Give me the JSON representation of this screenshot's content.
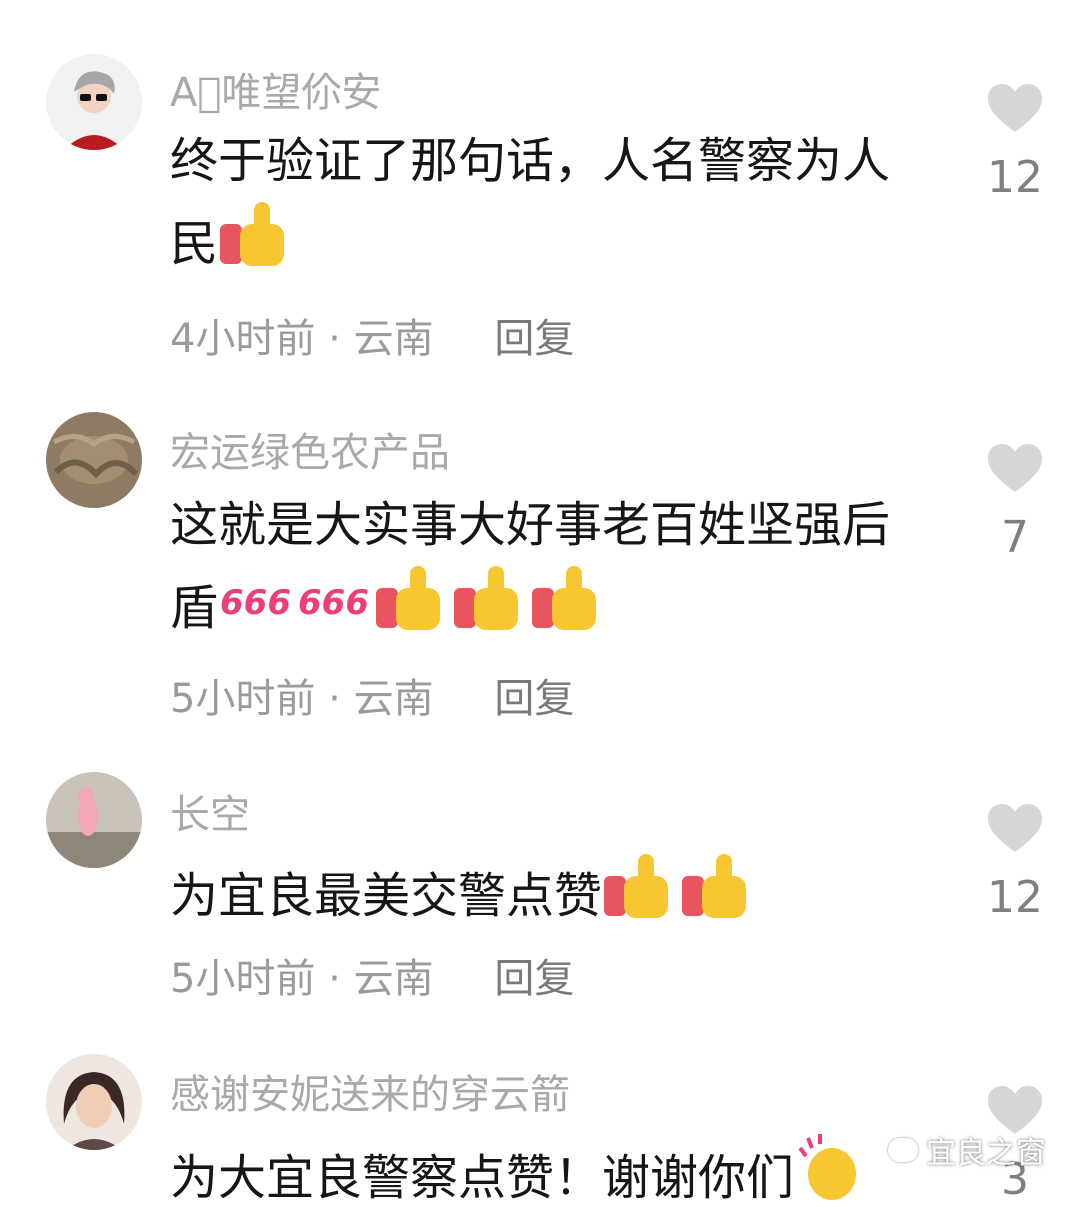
{
  "comments": [
    {
      "username": "A⃣唯望伱安",
      "text": "终于验证了那句话，人名警察为人民",
      "time": "4小时前",
      "location": "云南",
      "reply_label": "回复",
      "likes": "12",
      "emojis": [
        "thumbs-up"
      ]
    },
    {
      "username": "宏运绿色农产品",
      "text": "这就是大实事大好事老百姓坚强后盾",
      "time": "5小时前",
      "location": "云南",
      "reply_label": "回复",
      "likes": "7",
      "emojis": [
        "666",
        "666",
        "thumbs-up",
        "thumbs-up",
        "thumbs-up"
      ]
    },
    {
      "username": "长空",
      "text": "为宜良最美交警点赞",
      "time": "5小时前",
      "location": "云南",
      "reply_label": "回复",
      "likes": "12",
      "emojis": [
        "thumbs-up",
        "thumbs-up"
      ]
    },
    {
      "username": "感谢安妮送来的穿云箭",
      "text": "为大宜良警察点赞！谢谢你们",
      "likes": "3",
      "emojis": [
        "clapping-hands"
      ]
    }
  ],
  "separator": "·",
  "watermark": "宜良之窗",
  "colors": {
    "username": "#a9a9a9",
    "text": "#161616",
    "meta": "#9b9b9b",
    "heart": "#d6d6d6"
  }
}
